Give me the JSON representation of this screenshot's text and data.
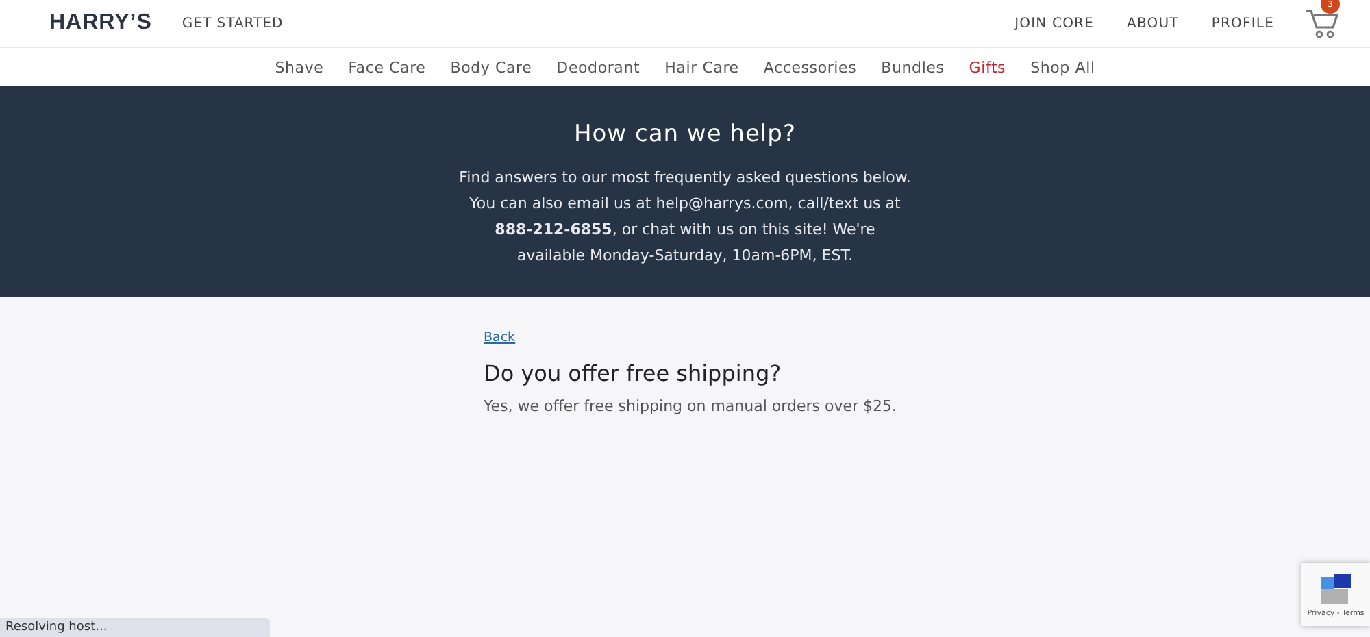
{
  "header": {
    "logo": "HARRY’S",
    "get_started": "GET STARTED",
    "links": [
      "JOIN CORE",
      "ABOUT",
      "PROFILE"
    ],
    "cart_count": "3"
  },
  "categories": [
    {
      "label": "Shave",
      "highlighted": false
    },
    {
      "label": "Face Care",
      "highlighted": false
    },
    {
      "label": "Body Care",
      "highlighted": false
    },
    {
      "label": "Deodorant",
      "highlighted": false
    },
    {
      "label": "Hair Care",
      "highlighted": false
    },
    {
      "label": "Accessories",
      "highlighted": false
    },
    {
      "label": "Bundles",
      "highlighted": false
    },
    {
      "label": "Gifts",
      "highlighted": true
    },
    {
      "label": "Shop All",
      "highlighted": false
    }
  ],
  "banner": {
    "title": "How can we help?",
    "text": "Find answers to our most frequently asked questions below. You can also email us at help@harrys.com, call/text us at **888-212-6855**, or chat with us on this site! We're available Monday-Saturday, 10am-6PM, EST."
  },
  "article": {
    "back": "Back",
    "question": "Do you offer free shipping?",
    "answer": "Yes, we offer free shipping on manual orders over $25."
  },
  "recaptcha": {
    "links": "Privacy - Terms"
  },
  "status_bar": "Resolving host..."
}
